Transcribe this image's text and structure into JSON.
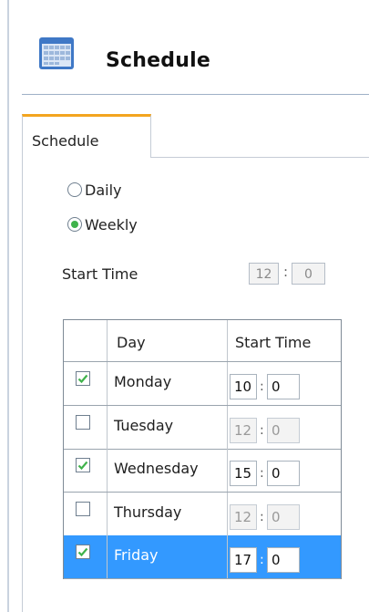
{
  "header": {
    "title": "Schedule",
    "icon": "calendar-icon"
  },
  "tabs": [
    {
      "label": "Schedule",
      "active": true
    }
  ],
  "frequency": {
    "options": [
      {
        "label": "Daily",
        "selected": false
      },
      {
        "label": "Weekly",
        "selected": true
      }
    ]
  },
  "start_time": {
    "label": "Start Time",
    "hour": "12",
    "minute": "0",
    "separator": ":"
  },
  "grid": {
    "columns": [
      "",
      "Day",
      "Start Time"
    ],
    "rows": [
      {
        "day": "Monday",
        "checked": true,
        "hour": "10",
        "minute": "0",
        "selected": false
      },
      {
        "day": "Tuesday",
        "checked": false,
        "hour": "12",
        "minute": "0",
        "selected": false
      },
      {
        "day": "Wednesday",
        "checked": true,
        "hour": "15",
        "minute": "0",
        "selected": false
      },
      {
        "day": "Thursday",
        "checked": false,
        "hour": "12",
        "minute": "0",
        "selected": false
      },
      {
        "day": "Friday",
        "checked": true,
        "hour": "17",
        "minute": "0",
        "selected": true
      }
    ]
  },
  "colors": {
    "tab_accent": "#f3a51f",
    "selection": "#3399ff",
    "check": "#3fb24b"
  }
}
